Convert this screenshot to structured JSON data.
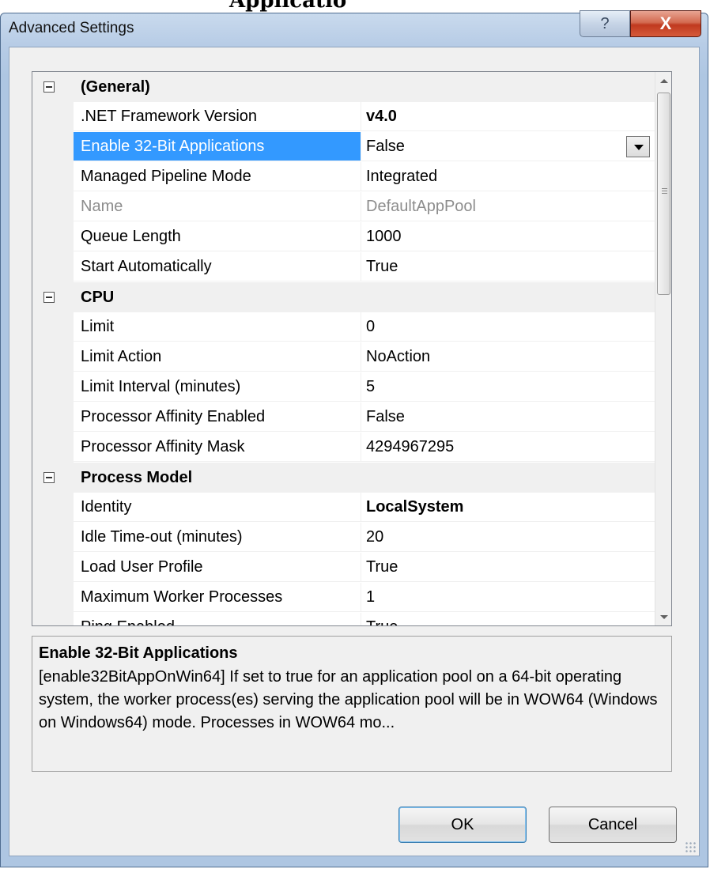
{
  "background": {
    "partial_title": "Applicatio"
  },
  "window": {
    "title": "Advanced Settings",
    "help_label": "?",
    "close_label": "X"
  },
  "grid": {
    "rows": [
      {
        "kind": "category",
        "label": "(General)"
      },
      {
        "kind": "property",
        "name": ".NET Framework Version",
        "value": "v4.0",
        "bold": true
      },
      {
        "kind": "property",
        "name": "Enable 32-Bit Applications",
        "value": "False",
        "selected": true
      },
      {
        "kind": "property",
        "name": "Managed Pipeline Mode",
        "value": "Integrated"
      },
      {
        "kind": "property",
        "name": "Name",
        "value": "DefaultAppPool",
        "disabled": true
      },
      {
        "kind": "property",
        "name": "Queue Length",
        "value": "1000"
      },
      {
        "kind": "property",
        "name": "Start Automatically",
        "value": "True"
      },
      {
        "kind": "category",
        "label": "CPU"
      },
      {
        "kind": "property",
        "name": "Limit",
        "value": "0"
      },
      {
        "kind": "property",
        "name": "Limit Action",
        "value": "NoAction"
      },
      {
        "kind": "property",
        "name": "Limit Interval (minutes)",
        "value": "5"
      },
      {
        "kind": "property",
        "name": "Processor Affinity Enabled",
        "value": "False"
      },
      {
        "kind": "property",
        "name": "Processor Affinity Mask",
        "value": "4294967295"
      },
      {
        "kind": "category",
        "label": "Process Model"
      },
      {
        "kind": "property",
        "name": "Identity",
        "value": "LocalSystem",
        "bold": true
      },
      {
        "kind": "property",
        "name": "Idle Time-out (minutes)",
        "value": "20"
      },
      {
        "kind": "property",
        "name": "Load User Profile",
        "value": "True"
      },
      {
        "kind": "property",
        "name": "Maximum Worker Processes",
        "value": "1"
      },
      {
        "kind": "property",
        "name": "Ping Enabled",
        "value": "True"
      }
    ]
  },
  "description": {
    "title": "Enable 32-Bit Applications",
    "text": "[enable32BitAppOnWin64] If set to true for an application pool on a 64-bit operating system, the worker process(es) serving the application pool will be in WOW64 (Windows on Windows64) mode. Processes in WOW64 mo..."
  },
  "buttons": {
    "ok": "OK",
    "cancel": "Cancel"
  },
  "colors": {
    "selection": "#3399ff",
    "close": "#c0391f",
    "title_bar": "#b7cce6"
  }
}
